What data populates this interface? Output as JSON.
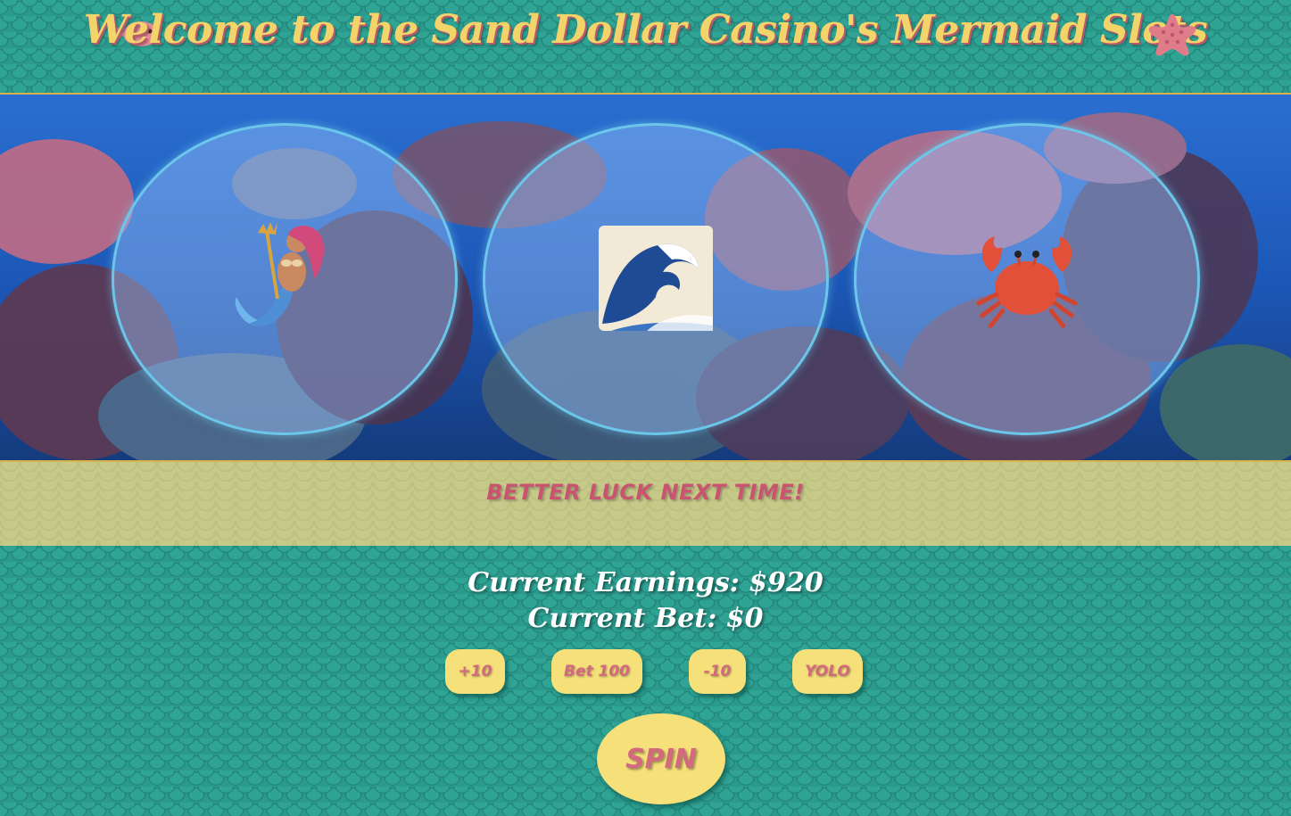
{
  "header": {
    "title": "Welcome to the Sand Dollar Casino's Mermaid Slots",
    "left_icon": "fish-icon",
    "right_icon": "starfish-icon"
  },
  "reels": [
    {
      "symbol": "mermaid",
      "icon": "mermaid-icon"
    },
    {
      "symbol": "wave",
      "icon": "wave-icon"
    },
    {
      "symbol": "crab",
      "icon": "crab-icon"
    }
  ],
  "message": "BETTER LUCK NEXT TIME!",
  "stats": {
    "earnings_label": "Current Earnings: $920",
    "bet_label": "Current Bet: $0"
  },
  "buttons": {
    "plus10": "+10",
    "bet100": "Bet 100",
    "minus10": "-10",
    "yolo": "YOLO",
    "spin": "SPIN"
  },
  "colors": {
    "teal_background": "#2b9a8c",
    "title_gold": "#f3d46a",
    "accent_pink": "#d2697f",
    "button_yellow": "#f5e07a",
    "message_bar": "#c6c988",
    "reel_border": "#6cc6ea"
  }
}
